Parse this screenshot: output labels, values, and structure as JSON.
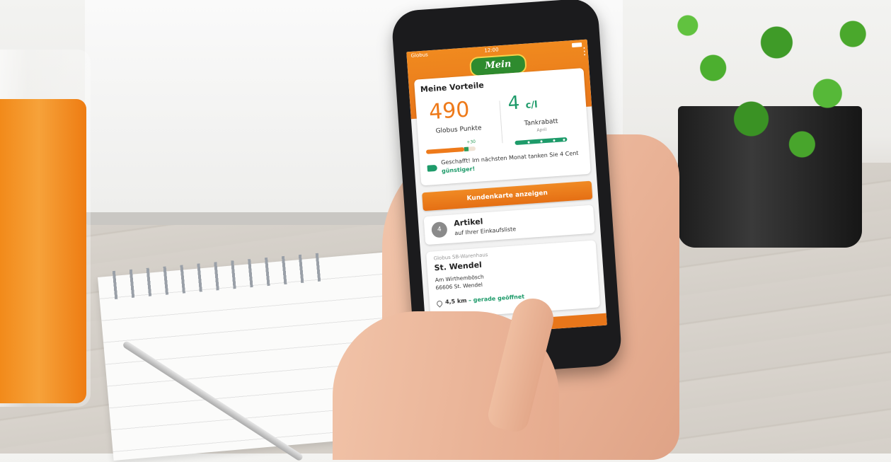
{
  "status_bar": {
    "carrier": "Globus",
    "time": "12:00"
  },
  "app": {
    "logo_text": "Mein Globus"
  },
  "vorteile": {
    "title": "Meine Vorteile",
    "points_value": "490",
    "points_label": "Globus Punkte",
    "points_bonus": "+30",
    "points_progress": 0.85,
    "tank_value": "4",
    "tank_unit": "c/l",
    "tank_label": "Tankrabatt",
    "tank_month": "April",
    "promo_text": "Geschafft! Im nächsten Monat tanken Sie 4 Cent ",
    "promo_highlight": "günstiger!"
  },
  "kundenkarte_button": "Kundenkarte anzeigen",
  "shopping_list": {
    "count": "4",
    "title": "Artikel",
    "subtitle": "auf Ihrer Einkaufsliste"
  },
  "store": {
    "chain": "Globus SB-Warenhaus",
    "name": "St. Wendel",
    "street": "Am Wirthembösch",
    "city": "66606 St. Wendel",
    "distance": "4,5 km",
    "status": "– gerade geöffnet"
  },
  "colors": {
    "accent_orange": "#e8761a",
    "accent_green": "#1e9b6a"
  }
}
